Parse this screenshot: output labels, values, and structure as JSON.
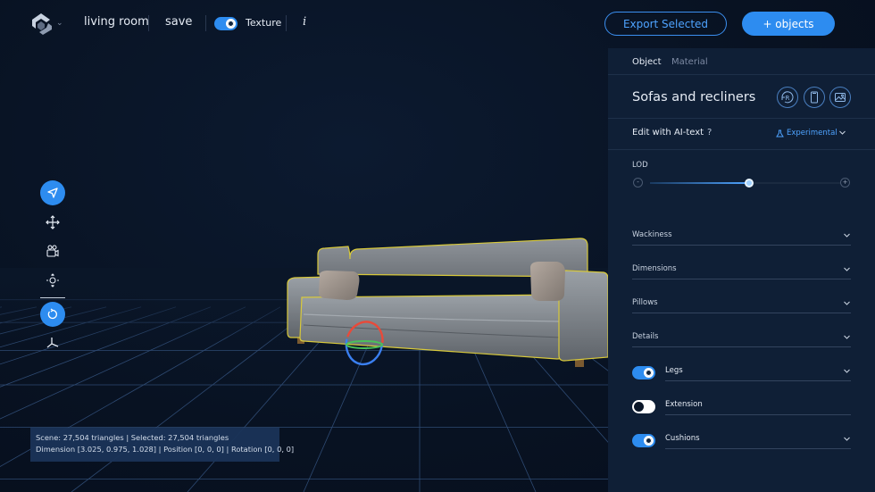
{
  "topbar": {
    "room_name": "living room",
    "save_label": "save",
    "texture_label": "Texture",
    "texture_enabled": true,
    "info_label": "i",
    "export_label": "Export Selected",
    "add_objects_label": "+ objects"
  },
  "colors": {
    "accent": "#2d8cf0",
    "background": "#0a1628",
    "panel": "#0f1f36",
    "selection_outline": "#d8c93a"
  },
  "toolbar": {
    "tools": [
      {
        "icon": "cursor-arrow-icon",
        "active": true
      },
      {
        "icon": "move-arrows-icon",
        "active": false
      },
      {
        "icon": "camera-icon",
        "active": false
      },
      {
        "icon": "orbit-target-icon",
        "active": false
      },
      {
        "icon": "rotate-icon",
        "active": true
      },
      {
        "icon": "axes-icon",
        "active": false
      }
    ]
  },
  "status": {
    "line1": "Scene: 27,504 triangles | Selected: 27,504 triangles",
    "line2": "Dimension [3.025, 0.975, 1.028] | Position [0, 0, 0] | Rotation [0, 0, 0]"
  },
  "panel": {
    "tabs": [
      {
        "label": "Object",
        "active": true
      },
      {
        "label": "Material",
        "active": false
      }
    ],
    "title": "Sofas and recliners",
    "title_buttons": [
      "r-badge-icon",
      "mobile-device-icon",
      "image-frame-icon"
    ],
    "ai_label": "Edit with AI-text",
    "ai_help": "?",
    "ai_mode": "Experimental",
    "lod": {
      "label": "LOD",
      "minus": "-",
      "plus": "+",
      "value": 0.52
    },
    "sections": [
      {
        "label": "Wackiness"
      },
      {
        "label": "Dimensions"
      },
      {
        "label": "Pillows"
      },
      {
        "label": "Details"
      }
    ],
    "options": [
      {
        "label": "Legs",
        "enabled": true,
        "expandable": true
      },
      {
        "label": "Extension",
        "enabled": false,
        "expandable": false
      },
      {
        "label": "Cushions",
        "enabled": true,
        "expandable": true
      }
    ]
  }
}
